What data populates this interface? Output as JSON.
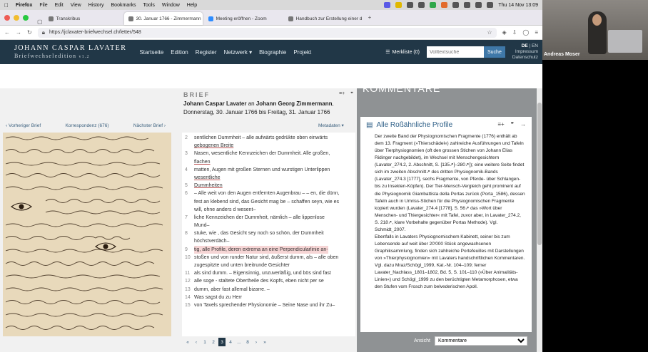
{
  "menubar": {
    "app": "Firefox",
    "items": [
      "File",
      "Edit",
      "View",
      "History",
      "Bookmarks",
      "Tools",
      "Window",
      "Help"
    ],
    "clock": "Thu 14 Nov 13:09"
  },
  "tabs": [
    {
      "label": "Transkribus"
    },
    {
      "label": "30. Januar 1766 - Zimmermann"
    },
    {
      "label": "Meeting eröffnen - Zoom"
    },
    {
      "label": "Handbuch zur Erstellung einer d"
    }
  ],
  "url": "https://jclavater-briefwechsel.ch/letter/548",
  "site": {
    "logo_line1": "JOHANN CASPAR LAVATER",
    "logo_line2": "Briefwechseledition",
    "logo_version": "v1.2",
    "nav": [
      "Startseite",
      "Edition",
      "Register",
      "Netzwerk ▾",
      "Biographie",
      "Projekt"
    ],
    "merkliste": "Merkliste (0)",
    "search_placeholder": "Volltextsuche",
    "search_button": "Suche",
    "lang_de": "DE",
    "lang_en": "EN",
    "impressum": "Impressum",
    "datenschutz": "Datenschutz"
  },
  "letter": {
    "label": "BRIEF",
    "author": "Johann Caspar Lavater",
    "conn": " an ",
    "recipient": "Johann Georg Zimmermann",
    "date": ", Donnerstag, 30. Januar 1766 bis Freitag, 31. Januar 1766",
    "prev": "‹ Vorheriger Brief",
    "corr": "Korrespondenz (676)",
    "next": "Nächster Brief ›",
    "meta": "Metadaten ▾"
  },
  "transcript": [
    {
      "n": "2",
      "t": "sentlichen Dummheit – alle aufwärts gedrükte oben einwärts"
    },
    {
      "n": "",
      "t": "gebogenen Breite"
    },
    {
      "n": "3",
      "t": "Nasen, wesentliche Kennzeichen der Dummheit. Alle großen,"
    },
    {
      "n": "",
      "t": "flachen"
    },
    {
      "n": "4",
      "t": "matten, Augen mit großen Sternen und wurstigen Unterlippen"
    },
    {
      "n": "",
      "t": "wesentliche"
    },
    {
      "n": "5",
      "t": "Dummheiten"
    },
    {
      "n": "6",
      "t": "– Alle weit von den Augen entfernten Augenbrau – – en, die dünn,"
    },
    {
      "n": "",
      "t": "fest an klebend sind, das Gesicht mag be – schaffen seyn, wie es"
    },
    {
      "n": "",
      "t": "will, ohne anders d wesent–"
    },
    {
      "n": "7",
      "t": "liche Kennzeichen der Dummheit, nämlich – alle lippenlose"
    },
    {
      "n": "",
      "t": "Mund–"
    },
    {
      "n": "8",
      "t": "stuke, wie , das Gesicht sey noch so schön, der Dummheit"
    },
    {
      "n": "",
      "t": "höchstverdäch–"
    },
    {
      "n": "9",
      "t": "tig, alle Profile, deren extrema an eine Perpendicularlinie an-"
    },
    {
      "n": "10",
      "t": "stoßen und von runder Natur sind, äußerst dumm, als – alle oben"
    },
    {
      "n": "",
      "t": "zugespitzte und unten breitrunde Gesichter"
    },
    {
      "n": "11",
      "t": "als sind dumm. – Eigensinnig, unzuverläßig, und bös sind fast"
    },
    {
      "n": "12",
      "t": "alle soge - staltete Obertheile des Kopfs, eben nicht per se"
    },
    {
      "n": "13",
      "t": "dumm, aber fast allemal bizarre. –"
    },
    {
      "n": "14",
      "t": "Was sagst du zu Herr"
    },
    {
      "n": "15",
      "t": "von Tavels sprechender Physionomie – Seine Nase und ihr Zu–"
    }
  ],
  "pagination": [
    "«",
    "‹",
    "1",
    "2",
    "3",
    "4",
    "...",
    "8",
    "›",
    "»"
  ],
  "pagination_current": "3",
  "kommentare": {
    "header": "KOMMENTARE",
    "title": "Alle Roßähnliche Profile",
    "body": "Der zweite Band der Physiognomischen Fragmente (1776) enthält ab dem 13. Fragment (»Thierschädel«) zahlreiche Ausführungen und Tafeln über Tierphysiognomien (oft den grossen Stichen von Johann Elias Ridinger nachgebildet), im Wechsel mit Menschengesichtern (Lavater_274.2, 2. Abschnitt, S. [135↗]–280↗]); eine weitere Seite findet sich im zweiten Abschnitt↗ des dritten Physiognomik-Bands (Lavater_274.3 [1777], sechs Fragmente, von Pferde- über Schlangen- bis zu Insekten-Köpfen). Der Tier-Mensch-Vergleich geht prominent auf die Physiognomik Giambattista della Portas zurück (Porta_1586), dessen Tafeln auch in Umriss-Stichen für die Physiognomischen Fragmente kopiert wurden (Lavater_274.4 [1778], S. 56↗ das »Wort über Menschen- und Thiergesichter« mit Tafel, zuvor aber, in Lavater_274.2, S. 218↗, klare Vorbehalte gegenüber Portas Methode). Vgl. Schmidt_2007.",
    "body2": "Ebenfalls in Lavaters Physiognomischem Kabinett, seiner bis zum Lebensende auf weit über 20'000 Stück angewachsenen Graphiksammlung, finden sich zahlreiche Portefeuilles mit Darstellungen von »Thierphysiognomien« mit Lavaters handschriftlichen Kommentaren. Vgl. dazu Mraz/Schögl_1999, Kat.-Nr. 104–109; ferner Lavater_Nachlass_1801–1802, Bd. 5, S. 101–110 (»Über Animalitäts-Linien«) und Schögl_1999 zu den berüchtigten Metamorphosen, etwa den Stufen vom Frosch zum belvederischen Apoll.",
    "ansicht_label": "Ansicht",
    "ansicht_value": "Kommentare"
  },
  "webcam": {
    "name": "Andreas Moser"
  }
}
